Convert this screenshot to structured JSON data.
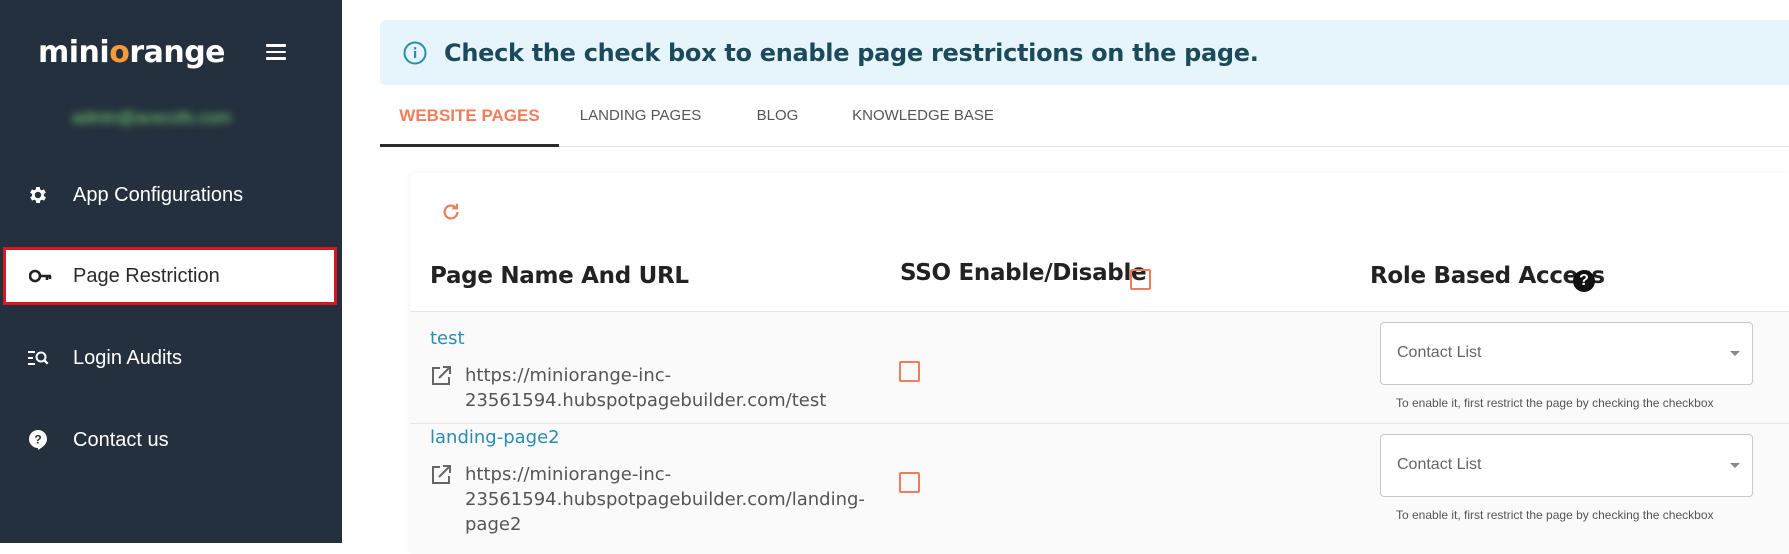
{
  "sidebar": {
    "logo": {
      "pre": "mini",
      "o": "o",
      "post": "range"
    },
    "user_email": "admin@acecofs.com",
    "items": [
      {
        "label": "App Configurations",
        "icon": "gear-icon"
      },
      {
        "label": "Page Restriction",
        "icon": "key-icon",
        "active": true
      },
      {
        "label": "Login Audits",
        "icon": "audit-search-icon"
      },
      {
        "label": "Contact us",
        "icon": "help-bubble-icon"
      }
    ]
  },
  "banner": {
    "text": "Check the check box to enable page restrictions on the page."
  },
  "tabs": [
    {
      "label": "WEBSITE PAGES",
      "active": true
    },
    {
      "label": "LANDING PAGES"
    },
    {
      "label": "BLOG"
    },
    {
      "label": "KNOWLEDGE BASE"
    }
  ],
  "table": {
    "headers": {
      "page_name": "Page Name And URL",
      "sso": "SSO Enable/Disable",
      "role": "Role Based Access"
    },
    "rows": [
      {
        "name": "test",
        "url": "https://miniorange-inc-23561594.hubspotpagebuilder.com/test",
        "role_value": "Contact List",
        "hint": "To enable it, first restrict the page by checking the checkbox"
      },
      {
        "name": "landing-page2",
        "url": "https://miniorange-inc-23561594.hubspotpagebuilder.com/landing-page2",
        "role_value": "Contact List",
        "hint": "To enable it, first restrict the page by checking the checkbox"
      }
    ]
  },
  "colors": {
    "sidebar_bg": "#24303d",
    "accent": "#f07e5a",
    "link": "#2a8cb0",
    "active_border": "#d7191f",
    "banner_bg": "#e5f5fb"
  }
}
